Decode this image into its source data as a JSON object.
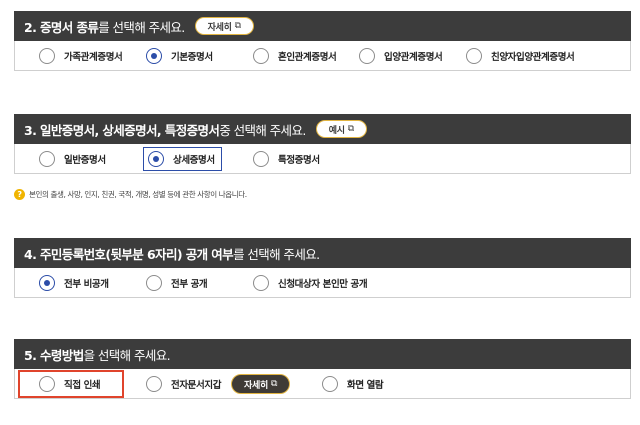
{
  "section2": {
    "title_bold": "2. 증명서 종류",
    "title_rest": "를 선택해 주세요.",
    "detail_button": "자세히",
    "ext_icon": "⧉",
    "options": [
      "가족관계증명서",
      "기본증명서",
      "혼인관계증명서",
      "입양관계증명서",
      "친양자입양관계증명서"
    ],
    "selected": "기본증명서"
  },
  "section3": {
    "title_bold": "3. 일반증명서, 상세증명서, 특정증명서",
    "title_rest": " 중 선택해 주세요.",
    "example_button": "예시",
    "ext_icon": "⧉",
    "options": [
      "일반증명서",
      "상세증명서",
      "특정증명서"
    ],
    "selected": "상세증명서",
    "note": "본인의 출생, 사망, 인지, 친권, 국적, 개명, 성별 등에 관한 사항이 나옵니다.",
    "note_icon": "?"
  },
  "section4": {
    "title_bold": "4. 주민등록번호(뒷부분 6자리) 공개 여부",
    "title_rest": "를 선택해 주세요.",
    "options": [
      "전부 비공개",
      "전부 공개",
      "신청대상자 본인만 공개"
    ],
    "selected": "전부 비공개"
  },
  "section5": {
    "title_bold": "5. 수령방법",
    "title_rest": "을 선택해 주세요.",
    "options": [
      "직접 인쇄",
      "전자문서지갑",
      "화면 열람"
    ],
    "detail_button": "자세히",
    "ext_icon": "⧉",
    "selected": "",
    "highlight_color": "#e0442c"
  },
  "colors": {
    "header_bg": "#3c3c3c",
    "accent_gold": "#e1b441",
    "radio_selected": "#2c4da8"
  }
}
